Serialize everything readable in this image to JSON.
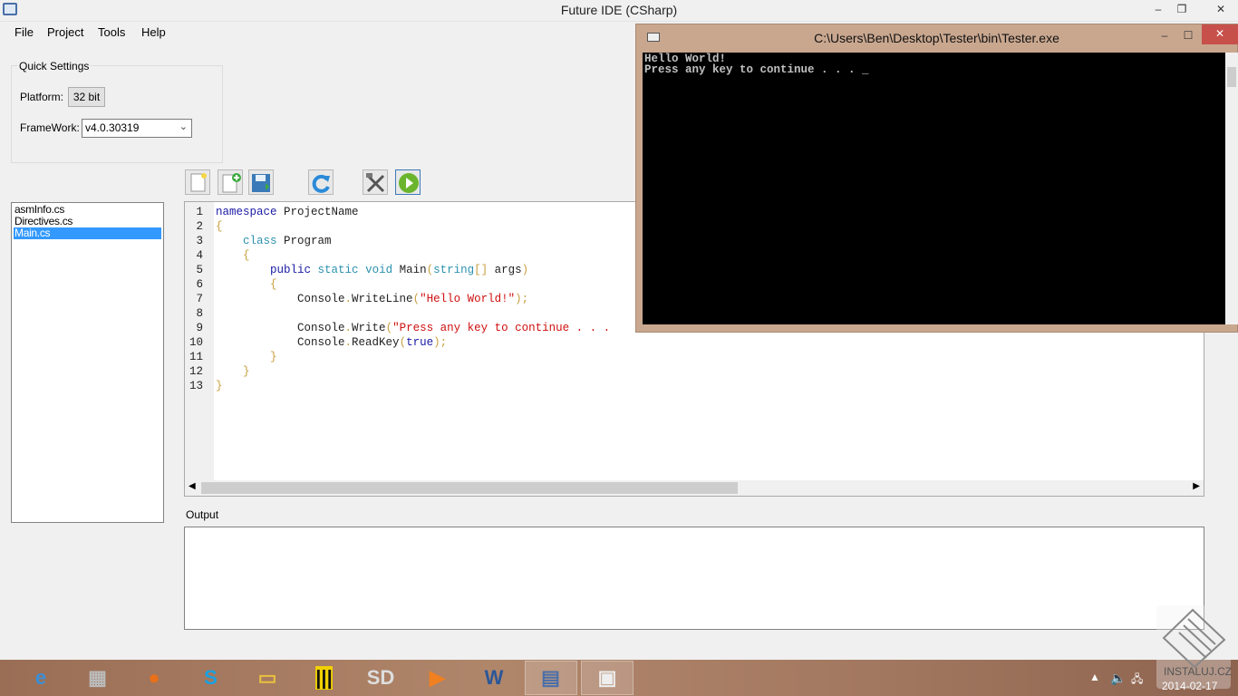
{
  "window": {
    "title": "Future IDE (CSharp)",
    "min": "–",
    "restore": "❐",
    "close": "✕"
  },
  "menu": [
    "File",
    "Project",
    "Tools",
    "Help"
  ],
  "quick_settings": {
    "legend": "Quick Settings",
    "platform_label": "Platform:",
    "platform_value": "32 bit",
    "framework_label": "FrameWork:",
    "framework_value": "v4.0.30319"
  },
  "toolbar": [
    "new-file",
    "add-file",
    "save",
    "refresh",
    "build-tools",
    "run"
  ],
  "files": [
    "asmInfo.cs",
    "Directives.cs",
    "Main.cs"
  ],
  "selected_file": "Main.cs",
  "code": [
    [
      [
        "namespace",
        "k"
      ],
      [
        " ProjectName",
        ""
      ]
    ],
    [
      [
        "{",
        "p"
      ]
    ],
    [
      [
        "    ",
        ""
      ],
      [
        "class",
        "t"
      ],
      [
        " Program",
        ""
      ]
    ],
    [
      [
        "    ",
        ""
      ],
      [
        "{",
        "p"
      ]
    ],
    [
      [
        "        ",
        ""
      ],
      [
        "public",
        "k"
      ],
      [
        " ",
        ""
      ],
      [
        "static",
        "t"
      ],
      [
        " ",
        ""
      ],
      [
        "void",
        "t"
      ],
      [
        " Main",
        ""
      ],
      [
        "(",
        "p"
      ],
      [
        "string",
        "t"
      ],
      [
        "[]",
        "p"
      ],
      [
        " args",
        ""
      ],
      [
        ")",
        "p"
      ]
    ],
    [
      [
        "        ",
        ""
      ],
      [
        "{",
        "p"
      ]
    ],
    [
      [
        "            Console",
        ""
      ],
      [
        ".",
        "p"
      ],
      [
        "WriteLine",
        ""
      ],
      [
        "(",
        "p"
      ],
      [
        "\"Hello World!\"",
        "s"
      ],
      [
        ");",
        "p"
      ]
    ],
    [],
    [
      [
        "            Console",
        ""
      ],
      [
        ".",
        "p"
      ],
      [
        "Write",
        ""
      ],
      [
        "(",
        "p"
      ],
      [
        "\"Press any key to continue . . .",
        "s"
      ]
    ],
    [
      [
        "            Console",
        ""
      ],
      [
        ".",
        "p"
      ],
      [
        "ReadKey",
        ""
      ],
      [
        "(",
        "p"
      ],
      [
        "true",
        "k"
      ],
      [
        ");",
        "p"
      ]
    ],
    [
      [
        "        ",
        ""
      ],
      [
        "}",
        "p"
      ]
    ],
    [
      [
        "    ",
        ""
      ],
      [
        "}",
        "p"
      ]
    ],
    [
      [
        "}",
        "p"
      ]
    ]
  ],
  "output": {
    "label": "Output",
    "text": ""
  },
  "console": {
    "title": "C:\\Users\\Ben\\Desktop\\Tester\\bin\\Tester.exe",
    "lines": [
      "Hello World!",
      "Press any key to continue . . . _"
    ]
  },
  "taskbar": {
    "apps": [
      "internet-explorer",
      "calculator",
      "firefox",
      "skype",
      "file-explorer",
      "app-stripes",
      "sharpdevelop",
      "media-player",
      "word",
      "future-ide",
      "console"
    ],
    "date": "2014-02-17",
    "watermark": "INSTALUJ.CZ"
  }
}
